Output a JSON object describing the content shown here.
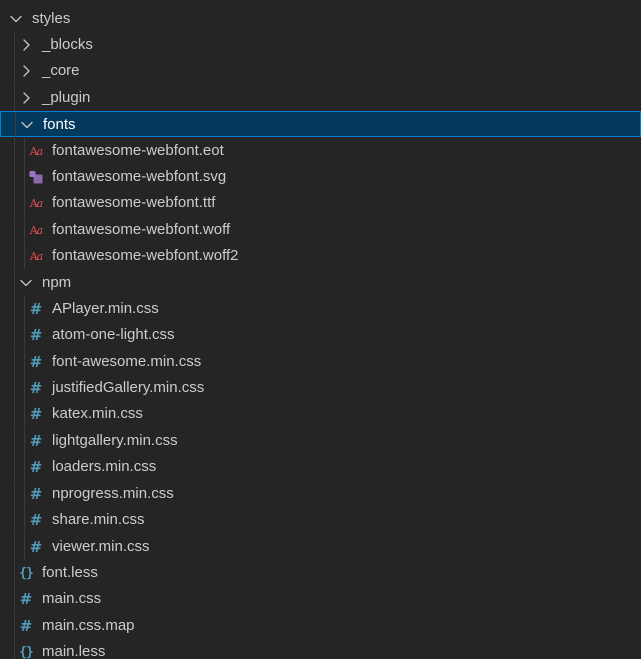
{
  "tree": [
    {
      "label": "styles",
      "type": "folder",
      "expanded": true,
      "depth": 0
    },
    {
      "label": "_blocks",
      "type": "folder",
      "expanded": false,
      "depth": 1
    },
    {
      "label": "_core",
      "type": "folder",
      "expanded": false,
      "depth": 1
    },
    {
      "label": "_plugin",
      "type": "folder",
      "expanded": false,
      "depth": 1
    },
    {
      "label": "fonts",
      "type": "folder",
      "expanded": true,
      "depth": 1,
      "selected": true
    },
    {
      "label": "fontawesome-webfont.eot",
      "type": "font",
      "depth": 2
    },
    {
      "label": "fontawesome-webfont.svg",
      "type": "svg",
      "depth": 2
    },
    {
      "label": "fontawesome-webfont.ttf",
      "type": "font",
      "depth": 2
    },
    {
      "label": "fontawesome-webfont.woff",
      "type": "font",
      "depth": 2
    },
    {
      "label": "fontawesome-webfont.woff2",
      "type": "font",
      "depth": 2
    },
    {
      "label": "npm",
      "type": "folder",
      "expanded": true,
      "depth": 1
    },
    {
      "label": "APlayer.min.css",
      "type": "css",
      "depth": 2
    },
    {
      "label": "atom-one-light.css",
      "type": "css",
      "depth": 2
    },
    {
      "label": "font-awesome.min.css",
      "type": "css",
      "depth": 2
    },
    {
      "label": "justifiedGallery.min.css",
      "type": "css",
      "depth": 2
    },
    {
      "label": "katex.min.css",
      "type": "css",
      "depth": 2
    },
    {
      "label": "lightgallery.min.css",
      "type": "css",
      "depth": 2
    },
    {
      "label": "loaders.min.css",
      "type": "css",
      "depth": 2
    },
    {
      "label": "nprogress.min.css",
      "type": "css",
      "depth": 2
    },
    {
      "label": "share.min.css",
      "type": "css",
      "depth": 2
    },
    {
      "label": "viewer.min.css",
      "type": "css",
      "depth": 2
    },
    {
      "label": "font.less",
      "type": "less",
      "depth": 1
    },
    {
      "label": "main.css",
      "type": "css",
      "depth": 1
    },
    {
      "label": "main.css.map",
      "type": "css",
      "depth": 1
    },
    {
      "label": "main.less",
      "type": "less",
      "depth": 1
    }
  ],
  "icons": {
    "folder": "chevron-icon",
    "css": "hash-icon",
    "less": "braces-icon",
    "font": "font-file-icon",
    "svg": "svg-file-icon"
  },
  "colors": {
    "background": "#252526",
    "text": "#cccccc",
    "selected_background": "#04395e",
    "selected_border": "#007fd4",
    "css_icon": "#519aba",
    "font_icon": "#e44d4d",
    "svg_icon": "#a074c4"
  }
}
